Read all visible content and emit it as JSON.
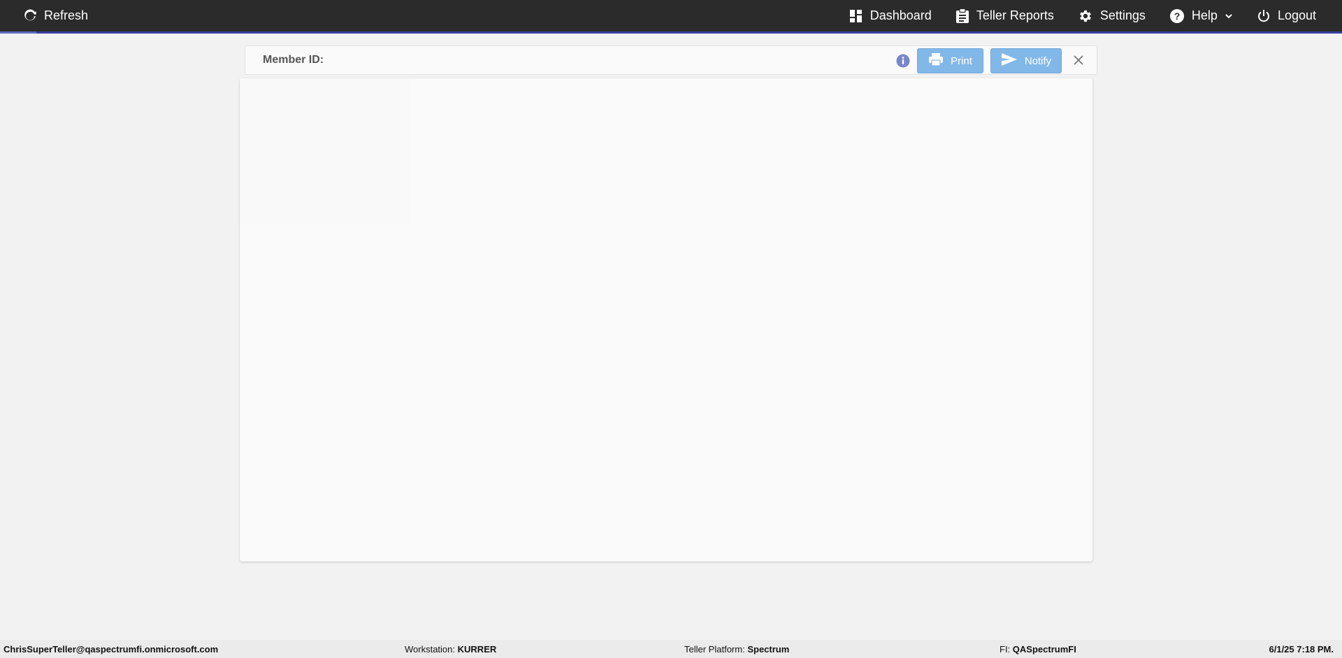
{
  "topbar": {
    "refresh_label": "Refresh",
    "nav": {
      "dashboard": "Dashboard",
      "teller_reports": "Teller Reports",
      "settings": "Settings",
      "help": "Help",
      "logout": "Logout"
    },
    "background_color": "#2b2b2b",
    "accent_color": "#3a3f9e"
  },
  "member_bar": {
    "label": "Member ID:",
    "input_value": "",
    "print_label": "Print",
    "notify_label": "Notify",
    "button_color": "#82b8e8",
    "info_icon_color": "#7986cb"
  },
  "statusbar": {
    "user": "ChrisSuperTeller@qaspectrumfi.onmicrosoft.com",
    "workstation_label": "Workstation:",
    "workstation_value": "KURRER",
    "platform_label": "Teller Platform:",
    "platform_value": "Spectrum",
    "fi_label": "FI:",
    "fi_value": "QASpectrumFI",
    "datetime": "6/1/25 7:18 PM."
  }
}
